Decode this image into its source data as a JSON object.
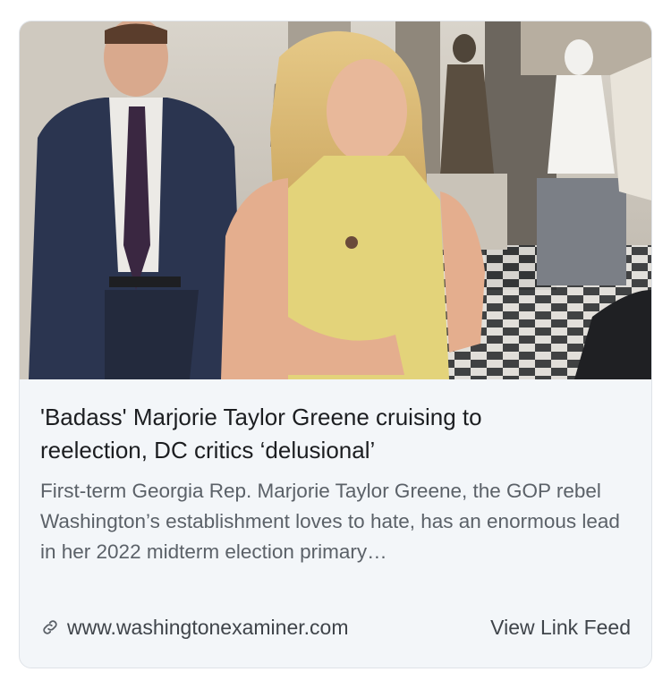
{
  "card": {
    "headline": "'Badass' Marjorie Taylor Greene cruising to reelection, DC critics ‘delusional’",
    "summary": "First-term Georgia Rep. Marjorie Taylor Greene, the GOP rebel Washington’s establishment loves to hate, has an enormous lead in her 2022 midterm election primary…",
    "domain": "www.washingtonexaminer.com",
    "view_link_feed_label": "View Link Feed",
    "link_icon": "link-icon"
  },
  "colors": {
    "card_background": "#f3f6f9",
    "border": "#dfe3e8",
    "headline_text": "#1c1e21",
    "summary_text": "#5b6168"
  }
}
